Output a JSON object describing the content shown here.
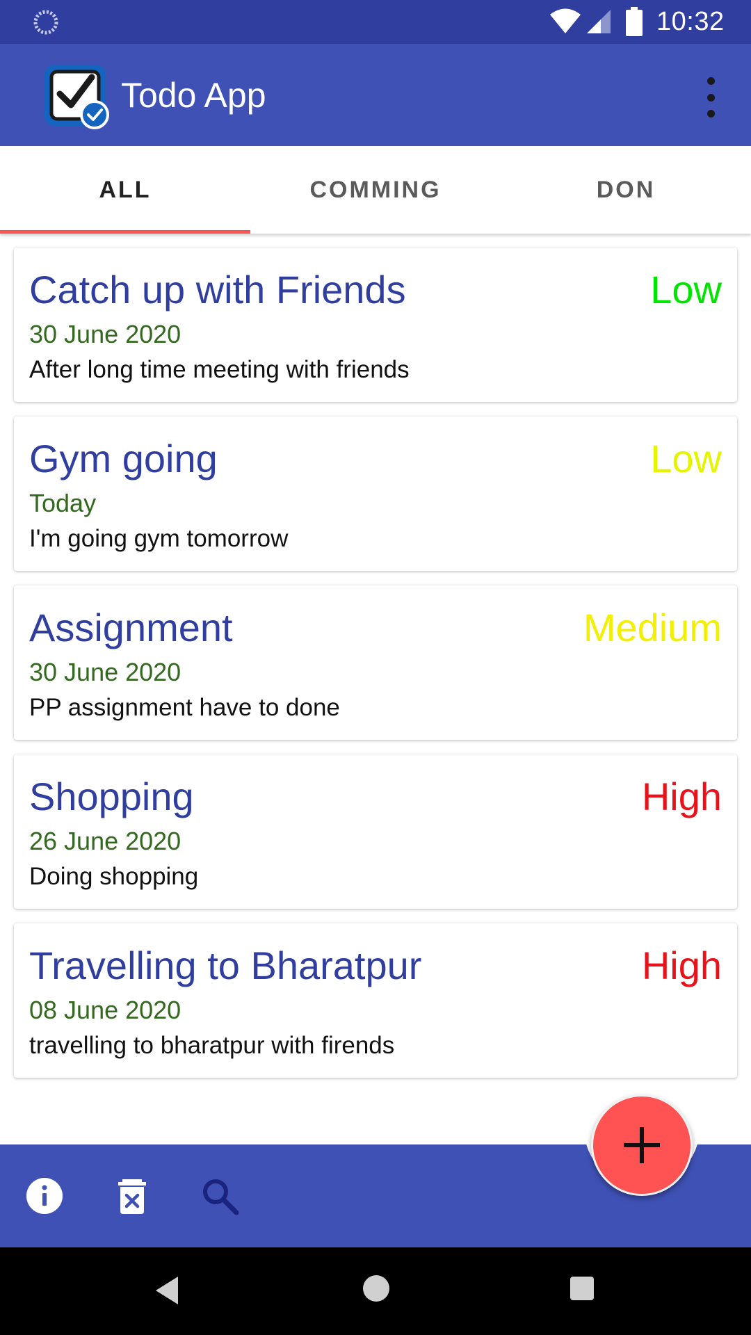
{
  "status_bar": {
    "time": "10:32",
    "icons": [
      "loading-spinner-icon",
      "wifi-icon",
      "cell-signal-icon",
      "battery-icon"
    ]
  },
  "app_bar": {
    "title": "Todo App",
    "logo_icon": "checkbox-check-icon",
    "menu_icon": "more-vert-icon"
  },
  "tabs": [
    {
      "label": "ALL",
      "active": true
    },
    {
      "label": "COMMING",
      "active": false
    },
    {
      "label": "DON",
      "active": false
    }
  ],
  "tasks": [
    {
      "title": "Catch up with Friends",
      "priority": "Low",
      "priority_color": "#00e400",
      "date": "30 June 2020",
      "description": "After long time meeting with friends"
    },
    {
      "title": "Gym going",
      "priority": "Low",
      "priority_color": "#e5f500",
      "date": "Today",
      "description": "I'm going gym tomorrow"
    },
    {
      "title": "Assignment",
      "priority": "Medium",
      "priority_color": "#f2f000",
      "date": "30 June 2020",
      "description": "PP assignment have to done"
    },
    {
      "title": "Shopping",
      "priority": "High",
      "priority_color": "#e8121b",
      "date": "26 June 2020",
      "description": "Doing shopping"
    },
    {
      "title": "Travelling to Bharatpur",
      "priority": "High",
      "priority_color": "#e8121b",
      "date": "08 June 2020",
      "description": "travelling to bharatpur with firends"
    }
  ],
  "bottom_bar": {
    "icons": [
      "info-icon",
      "delete-icon",
      "search-icon"
    ]
  },
  "fab": {
    "icon": "add-icon",
    "color": "#ff5252"
  },
  "colors": {
    "primary": "#3f51b5",
    "primary_dark": "#303f9f",
    "accent": "#ff5252",
    "date_text": "#33691e"
  }
}
